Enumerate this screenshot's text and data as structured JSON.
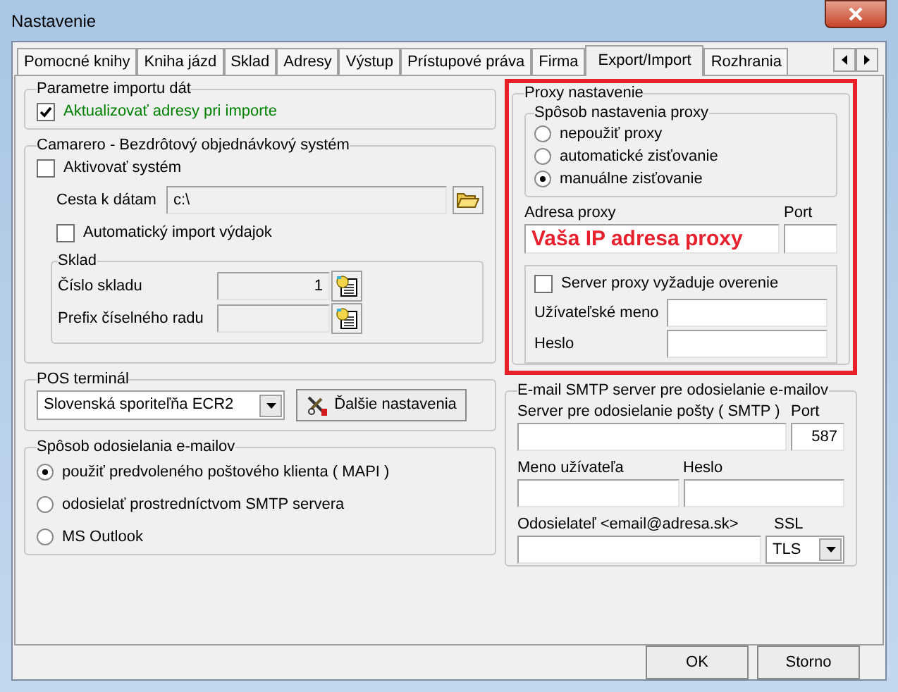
{
  "window": {
    "title": "Nastavenie"
  },
  "tabs": [
    {
      "label": "Pomocné knihy",
      "selected": false
    },
    {
      "label": "Kniha jázd",
      "selected": false
    },
    {
      "label": "Sklad",
      "selected": false
    },
    {
      "label": "Adresy",
      "selected": false
    },
    {
      "label": "Výstup",
      "selected": false
    },
    {
      "label": "Prístupové práva",
      "selected": false
    },
    {
      "label": "Firma",
      "selected": false
    },
    {
      "label": "Export/Import",
      "selected": true
    },
    {
      "label": "Rozhrania",
      "selected": false
    }
  ],
  "import_params": {
    "title": "Parametre importu dát",
    "checkbox": {
      "label": "Aktualizovať adresy pri importe",
      "checked": true
    }
  },
  "camarero": {
    "title": "Camarero -  Bezdrôtový objednávkový systém",
    "activate": {
      "label": "Aktivovať systém",
      "checked": false
    },
    "path": {
      "label": "Cesta k dátam",
      "value": "c:\\",
      "disabled": true
    },
    "auto_import": {
      "label": "Automatický import výdajok",
      "checked": false
    },
    "sklad": {
      "title": "Sklad",
      "fields": [
        {
          "label": "Číslo skladu",
          "value": "1",
          "disabled": true
        },
        {
          "label": "Prefix číselného radu",
          "disabled": true
        }
      ]
    }
  },
  "pos": {
    "title": "POS terminál",
    "select": {
      "value": "Slovenská sporiteľňa ECR2"
    },
    "button": {
      "label": "Ďalšie nastavenia"
    }
  },
  "email_method": {
    "title": "Spôsob odosielania e-mailov",
    "options": [
      {
        "label": "použiť predvoleného poštového klienta ( MAPI )",
        "selected": true
      },
      {
        "label": "odosielať prostredníctvom SMTP servera",
        "selected": false
      },
      {
        "label": "MS Outlook",
        "selected": false
      }
    ]
  },
  "proxy": {
    "title": "Proxy nastavenie",
    "method": {
      "title": "Spôsob nastavenia proxy",
      "options": [
        {
          "label": "nepoužiť proxy",
          "selected": false
        },
        {
          "label": "automatické zisťovanie",
          "selected": false
        },
        {
          "label": "manuálne zisťovanie",
          "selected": true
        }
      ]
    },
    "address": {
      "label": "Adresa proxy",
      "value": "Vaša IP adresa proxy"
    },
    "port": {
      "label": "Port"
    },
    "auth": {
      "checkbox": {
        "label": "Server proxy vyžaduje overenie",
        "checked": false
      },
      "fields": [
        {
          "label": "Užívateľské meno"
        },
        {
          "label": "Heslo"
        }
      ]
    }
  },
  "smtp": {
    "title": "E-mail SMTP server pre odosielanie e-mailov",
    "server": {
      "label": "Server pre odosielanie pošty ( SMTP )"
    },
    "port": {
      "label": "Port",
      "value": "587"
    },
    "user": {
      "label": "Meno užívateľa"
    },
    "password": {
      "label": "Heslo"
    },
    "sender": {
      "label": "Odosielateľ <email@adresa.sk>"
    },
    "ssl": {
      "label": "SSL",
      "value": "TLS"
    }
  },
  "buttons": [
    {
      "label": "OK"
    },
    {
      "label": "Storno"
    }
  ]
}
